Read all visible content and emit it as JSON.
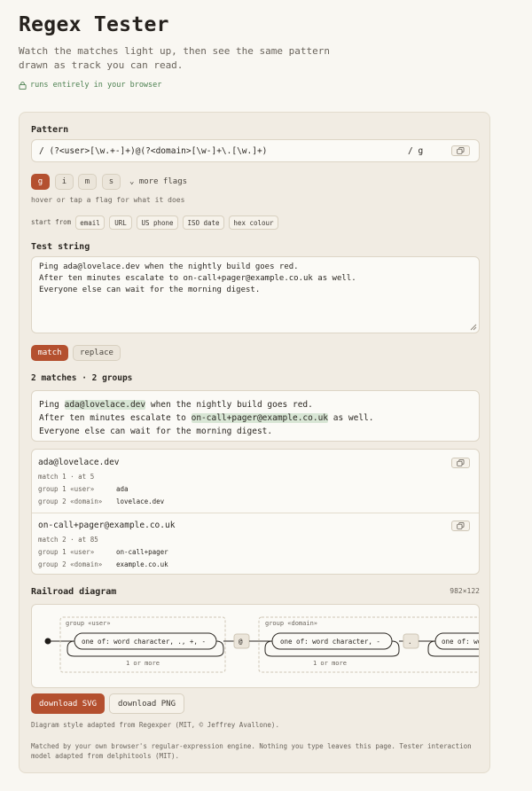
{
  "header": {
    "title": "Regex Tester",
    "subtitle": "Watch the matches light up, then see the same pattern drawn as track you can read.",
    "local_note": "runs entirely in your browser"
  },
  "pattern": {
    "label": "Pattern",
    "open_delim": "/",
    "value": "(?<user>[\\w.+-]+)@(?<domain>[\\w-]+\\.[\\w.]+)",
    "close_delim": "/ g"
  },
  "flags": {
    "items": [
      {
        "label": "g",
        "active": true
      },
      {
        "label": "i",
        "active": false
      },
      {
        "label": "m",
        "active": false
      },
      {
        "label": "s",
        "active": false
      }
    ],
    "more_label": "more flags",
    "hint": "hover or tap a flag for what it does"
  },
  "presets": {
    "label": "start from",
    "items": [
      "email",
      "URL",
      "US phone",
      "ISO date",
      "hex colour"
    ]
  },
  "test_string": {
    "label": "Test string",
    "value": "Ping ada@lovelace.dev when the nightly build goes red.\nAfter ten minutes escalate to on-call+pager@example.co.uk as well.\nEveryone else can wait for the morning digest."
  },
  "modes": [
    {
      "label": "match",
      "active": true
    },
    {
      "label": "replace",
      "active": false
    }
  ],
  "summary": "2 matches · 2 groups",
  "highlighted": {
    "line1_pre": "Ping ",
    "line1_match": "ada@lovelace.dev",
    "line1_post": " when the nightly build goes red.",
    "line2_pre": "After ten minutes escalate to ",
    "line2_match": "on-call+pager@example.co.uk",
    "line2_post": " as well.",
    "line3": "Everyone else can wait for the morning digest."
  },
  "matches": [
    {
      "text": "ada@lovelace.dev",
      "meta": "match 1 · at 5",
      "groups": [
        {
          "name": "group 1 «user»",
          "value": "ada"
        },
        {
          "name": "group 2 «domain»",
          "value": "lovelace.dev"
        }
      ]
    },
    {
      "text": "on-call+pager@example.co.uk",
      "meta": "match 2 · at 85",
      "groups": [
        {
          "name": "group 1 «user»",
          "value": "on-call+pager"
        },
        {
          "name": "group 2 «domain»",
          "value": "example.co.uk"
        }
      ]
    }
  ],
  "railroad": {
    "label": "Railroad diagram",
    "dimensions": "982×122",
    "group_user": "group «user»",
    "group_domain": "group «domain»",
    "node1": "one of: word character, ., +, -",
    "at": "@",
    "node2": "one of: word character, -",
    "dot": ".",
    "node3": "one of: wo",
    "repeat1": "1 or more",
    "repeat2": "1 or more"
  },
  "downloads": {
    "svg": "download SVG",
    "png": "download PNG"
  },
  "credit": "Diagram style adapted from Regexper (MIT, © Jeffrey Avallone).",
  "footer": "Matched by your own browser's regular-expression engine. Nothing you type leaves this page. Tester interaction model adapted from delphitools (MIT).",
  "colors": {
    "accent": "#b4502f",
    "match_highlight": "#d8e6d5",
    "local_note": "#4c8050"
  }
}
